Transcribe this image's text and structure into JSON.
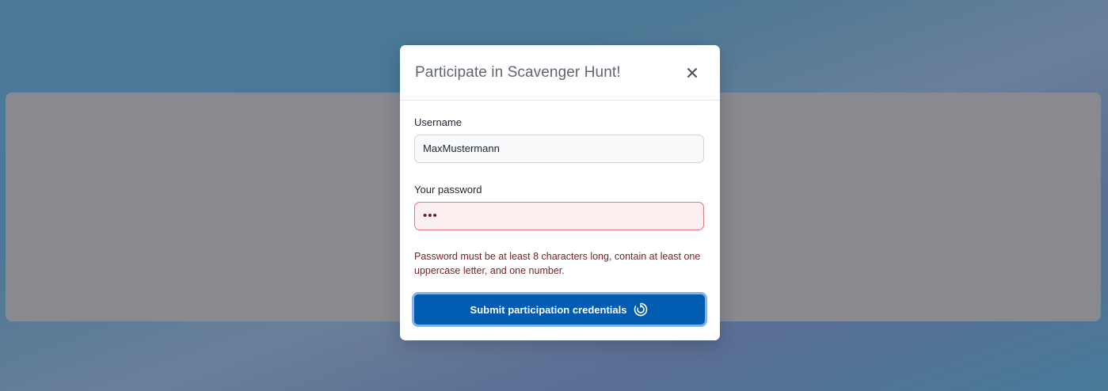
{
  "dialog": {
    "title": "Participate in Scavenger Hunt!",
    "close_icon": "close-icon"
  },
  "form": {
    "username": {
      "label": "Username",
      "value": "MaxMustermann"
    },
    "password": {
      "label": "Your password",
      "value": "•••"
    },
    "error_message": "Password must be at least 8 characters long, contain at least one uppercase letter, and one number.",
    "submit": {
      "label": "Submit participation credentials",
      "icon": "loading-spinner-icon"
    }
  },
  "colors": {
    "primary": "#005cb0",
    "error": "#7a1f1f",
    "error_border": "#e2777e"
  }
}
